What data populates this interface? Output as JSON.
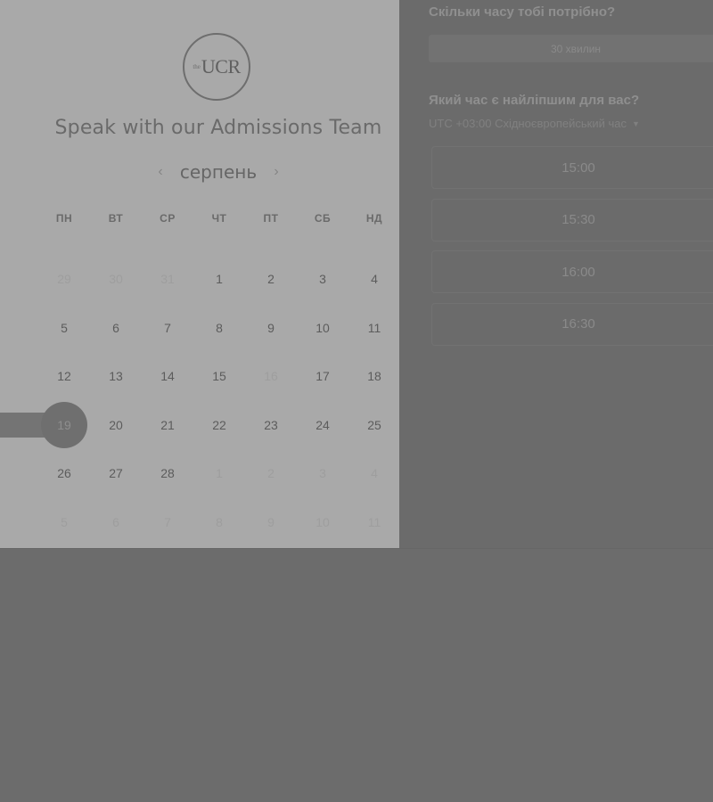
{
  "logo": {
    "main": "UCR",
    "small": "the"
  },
  "title": "Speak with our Admissions Team",
  "calendar": {
    "month": "серпень",
    "prev_icon": "chevron-left-icon",
    "next_icon": "chevron-right-icon",
    "weekdays": [
      "ПН",
      "ВТ",
      "СР",
      "ЧТ",
      "ПТ",
      "СБ",
      "НД"
    ],
    "days": [
      {
        "n": "29",
        "state": "muted"
      },
      {
        "n": "30",
        "state": "muted"
      },
      {
        "n": "31",
        "state": "muted"
      },
      {
        "n": "1",
        "state": "normal"
      },
      {
        "n": "2",
        "state": "normal"
      },
      {
        "n": "3",
        "state": "normal"
      },
      {
        "n": "4",
        "state": "normal"
      },
      {
        "n": "5",
        "state": "normal"
      },
      {
        "n": "6",
        "state": "normal"
      },
      {
        "n": "7",
        "state": "normal"
      },
      {
        "n": "8",
        "state": "normal"
      },
      {
        "n": "9",
        "state": "normal"
      },
      {
        "n": "10",
        "state": "normal"
      },
      {
        "n": "11",
        "state": "normal"
      },
      {
        "n": "12",
        "state": "normal"
      },
      {
        "n": "13",
        "state": "normal"
      },
      {
        "n": "14",
        "state": "normal"
      },
      {
        "n": "15",
        "state": "normal"
      },
      {
        "n": "16",
        "state": "muted"
      },
      {
        "n": "17",
        "state": "normal"
      },
      {
        "n": "18",
        "state": "normal"
      },
      {
        "n": "19",
        "state": "selected"
      },
      {
        "n": "20",
        "state": "normal"
      },
      {
        "n": "21",
        "state": "normal"
      },
      {
        "n": "22",
        "state": "normal"
      },
      {
        "n": "23",
        "state": "normal"
      },
      {
        "n": "24",
        "state": "normal"
      },
      {
        "n": "25",
        "state": "normal"
      },
      {
        "n": "26",
        "state": "normal"
      },
      {
        "n": "27",
        "state": "normal"
      },
      {
        "n": "28",
        "state": "normal"
      },
      {
        "n": "1",
        "state": "muted"
      },
      {
        "n": "2",
        "state": "muted"
      },
      {
        "n": "3",
        "state": "muted"
      },
      {
        "n": "4",
        "state": "muted"
      },
      {
        "n": "5",
        "state": "muted"
      },
      {
        "n": "6",
        "state": "muted"
      },
      {
        "n": "7",
        "state": "muted"
      },
      {
        "n": "8",
        "state": "muted"
      },
      {
        "n": "9",
        "state": "muted"
      },
      {
        "n": "10",
        "state": "muted"
      },
      {
        "n": "11",
        "state": "muted"
      }
    ]
  },
  "booking": {
    "duration_label": "Скільки часу тобі потрібно?",
    "duration_value": "30 хвилин",
    "time_label": "Який час є найліпшим для вас?",
    "timezone": "UTC +03:00 Східноєвропейський час",
    "timezone_icon": "caret-down-icon",
    "slots": [
      "15:00",
      "15:30",
      "16:00",
      "16:30"
    ]
  }
}
